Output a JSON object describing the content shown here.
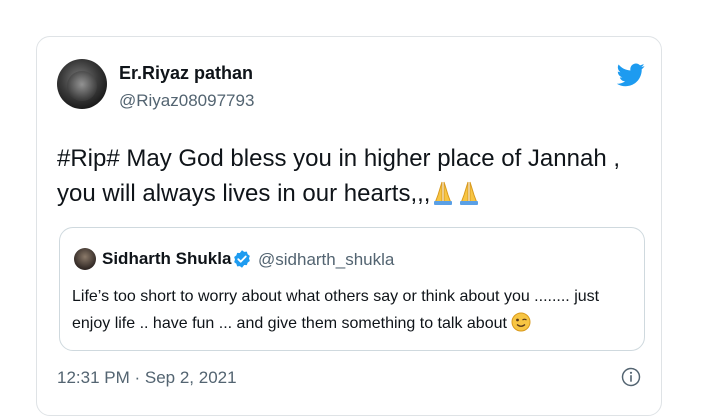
{
  "author": {
    "display_name": "Er.Riyaz pathan",
    "handle": "@Riyaz08097793"
  },
  "tweet": {
    "text": "#Rip# May God bless you in higher place of Jannah , you will always lives in our hearts,,,",
    "emoji": [
      "folded-hands",
      "folded-hands"
    ],
    "timestamp": "12:31 PM · Sep 2, 2021"
  },
  "quoted_tweet": {
    "display_name": "Sidharth Shukla",
    "handle": "@sidharth_shukla",
    "verified": true,
    "text": "Life’s too short to worry about what others say or think about you ........ just enjoy life .. have fun ... and give them something to talk about",
    "emoji": "winking-face"
  },
  "colors": {
    "twitter_blue": "#1d9bf0",
    "secondary_text": "#536471",
    "border": "#cfd9de"
  }
}
